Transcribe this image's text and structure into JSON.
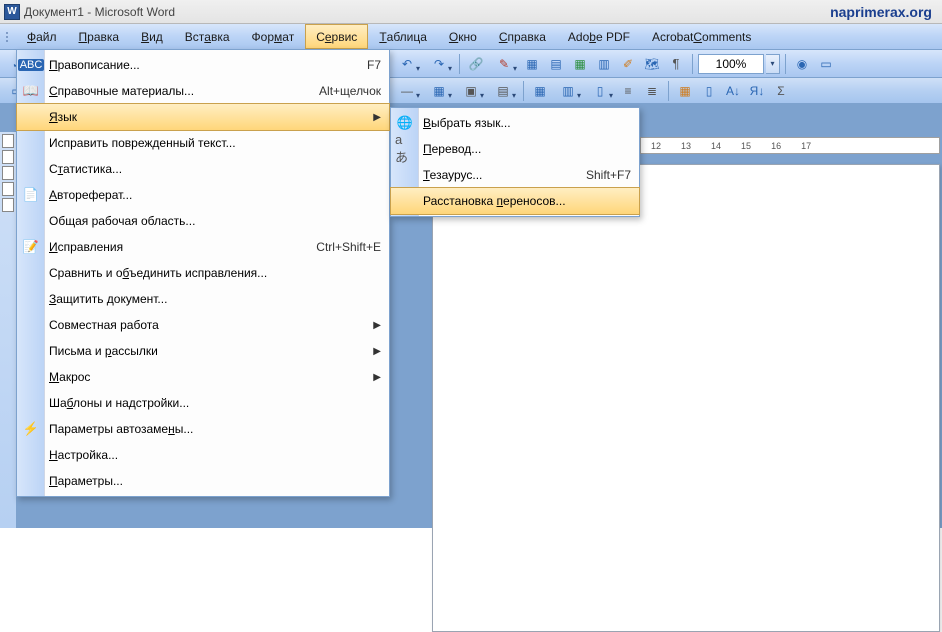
{
  "title": "Документ1 - Microsoft Word",
  "brand": "naprimerax.org",
  "menubar": {
    "file": "Файл",
    "edit": "Правка",
    "view": "Вид",
    "insert": "Вставка",
    "format": "Формат",
    "service": "Сервис",
    "table": "Таблица",
    "window": "Окно",
    "help": "Справка",
    "adobe": "Adobe PDF",
    "acrobat": "Acrobat Comments"
  },
  "toolbar": {
    "zoom": "100%"
  },
  "ruler": {
    "marks": [
      "12",
      "13",
      "14",
      "15",
      "16",
      "17"
    ]
  },
  "service_menu": {
    "spelling": "Правописание...",
    "spelling_key": "F7",
    "reference": "Справочные материалы...",
    "reference_key": "Alt+щелчок",
    "language": "Язык",
    "fix_text": "Исправить поврежденный текст...",
    "statistics": "Статистика...",
    "autoabstract": "Автореферат...",
    "workspace": "Общая рабочая область...",
    "track_changes": "Исправления",
    "track_changes_key": "Ctrl+Shift+E",
    "compare": "Сравнить и объединить исправления...",
    "protect": "Защитить документ...",
    "collab": "Совместная работа",
    "mailings": "Письма и рассылки",
    "macro": "Макрос",
    "templates": "Шаблоны и надстройки...",
    "autocorrect": "Параметры автозамены...",
    "customize": "Настройка...",
    "options": "Параметры..."
  },
  "language_submenu": {
    "choose": "Выбрать язык...",
    "translate": "Перевод...",
    "thesaurus": "Тезаурус...",
    "thesaurus_key": "Shift+F7",
    "hyphenation": "Расстановка переносов..."
  }
}
